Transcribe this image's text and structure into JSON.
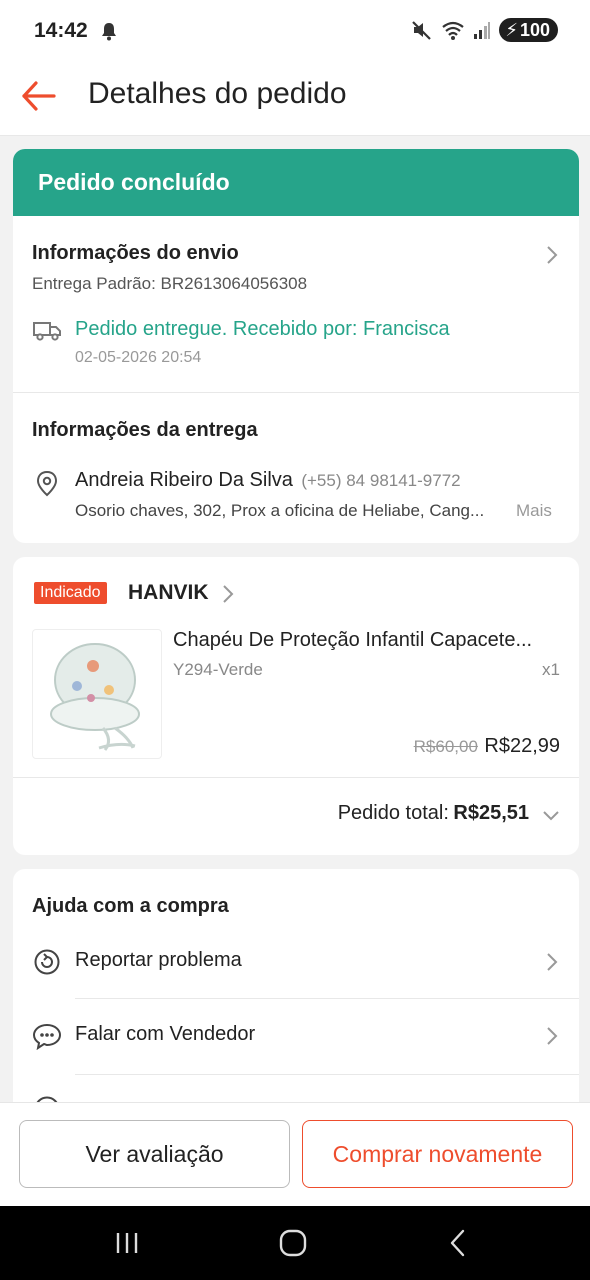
{
  "status_bar": {
    "time": "14:42",
    "battery": "100"
  },
  "header": {
    "title": "Detalhes do pedido"
  },
  "order_status": "Pedido concluído",
  "shipping": {
    "title": "Informações do envio",
    "method": "Entrega Padrão: BR2613064056308",
    "event": "Pedido entregue. Recebido por: Francisca",
    "timestamp": "02-05-2026 20:54"
  },
  "delivery": {
    "title": "Informações da entrega",
    "name": "Andreia Ribeiro Da Silva",
    "phone": "(+55) 84 98141-9772",
    "address": "Osorio chaves, 302, Prox a oficina de Heliabe, Cang...",
    "more": "Mais"
  },
  "shop": {
    "badge": "Indicado",
    "name": "HANVIK",
    "product": {
      "name": "Chapéu De Proteção Infantil Capacete...",
      "variant": "Y294-Verde",
      "qty": "x1",
      "old_price": "R$60,00",
      "price": "R$22,99"
    },
    "total_label": "Pedido total:",
    "total_value": "R$25,51"
  },
  "help": {
    "title": "Ajuda com a compra",
    "items": [
      {
        "label": "Reportar problema"
      },
      {
        "label": "Falar com Vendedor"
      }
    ]
  },
  "actions": {
    "review": "Ver avaliação",
    "buy_again": "Comprar novamente"
  },
  "colors": {
    "accent": "#ee4d2d",
    "success": "#26a48a"
  }
}
